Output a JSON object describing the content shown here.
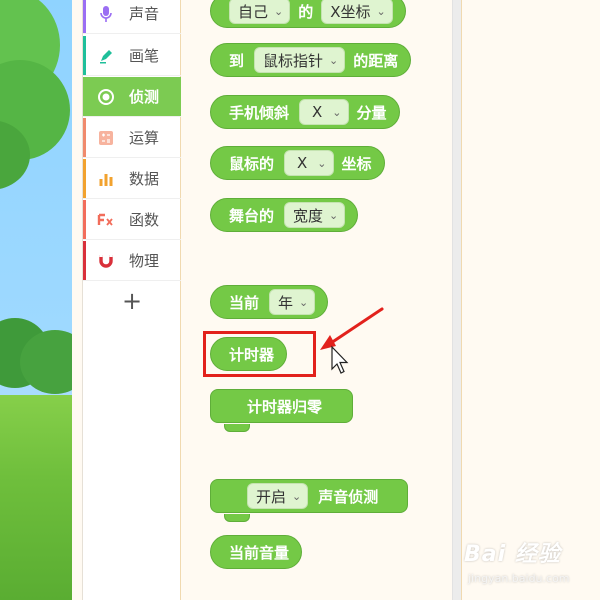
{
  "categories": [
    {
      "label": "声音",
      "icon": "microphone-icon",
      "color": "#9b6ef3",
      "active": false
    },
    {
      "label": "画笔",
      "icon": "pen-icon",
      "color": "#1fbf9a",
      "active": false
    },
    {
      "label": "侦测",
      "icon": "radio-target-icon",
      "color": "#7ccb52",
      "active": true
    },
    {
      "label": "运算",
      "icon": "calculator-icon",
      "color": "#f08a6c",
      "active": false
    },
    {
      "label": "数据",
      "icon": "bar-chart-icon",
      "color": "#f2a22e",
      "active": false
    },
    {
      "label": "函数",
      "icon": "function-icon",
      "color": "#f26d5b",
      "active": false
    },
    {
      "label": "物理",
      "icon": "magnet-icon",
      "color": "#d9303a",
      "active": false
    }
  ],
  "add_extension_label": "+",
  "blocks": {
    "self_of": {
      "dropdown1": "自己",
      "text": "的",
      "dropdown2": "X坐标"
    },
    "distance_to": {
      "text1": "到",
      "dropdown": "鼠标指针",
      "text2": "的距离"
    },
    "phone_tilt": {
      "text1": "手机倾斜",
      "dropdown": "X",
      "text2": "分量"
    },
    "mouse_coord": {
      "text1": "鼠标的",
      "dropdown": "X",
      "text2": "坐标"
    },
    "stage_of": {
      "text1": "舞台的",
      "dropdown": "宽度"
    },
    "current": {
      "text1": "当前",
      "dropdown": "年"
    },
    "timer": {
      "text": "计时器"
    },
    "reset_timer": {
      "text": "计时器归零"
    },
    "enable_sound_detect": {
      "dropdown": "开启",
      "text": "声音侦测"
    },
    "current_volume": {
      "text": "当前音量"
    }
  },
  "colors": {
    "block_green": "#74c946",
    "active_category": "#7ccb52",
    "highlight_red": "#e2211c"
  },
  "watermark": {
    "logo": "Bai 经验",
    "url": "jingyan.baidu.com"
  }
}
